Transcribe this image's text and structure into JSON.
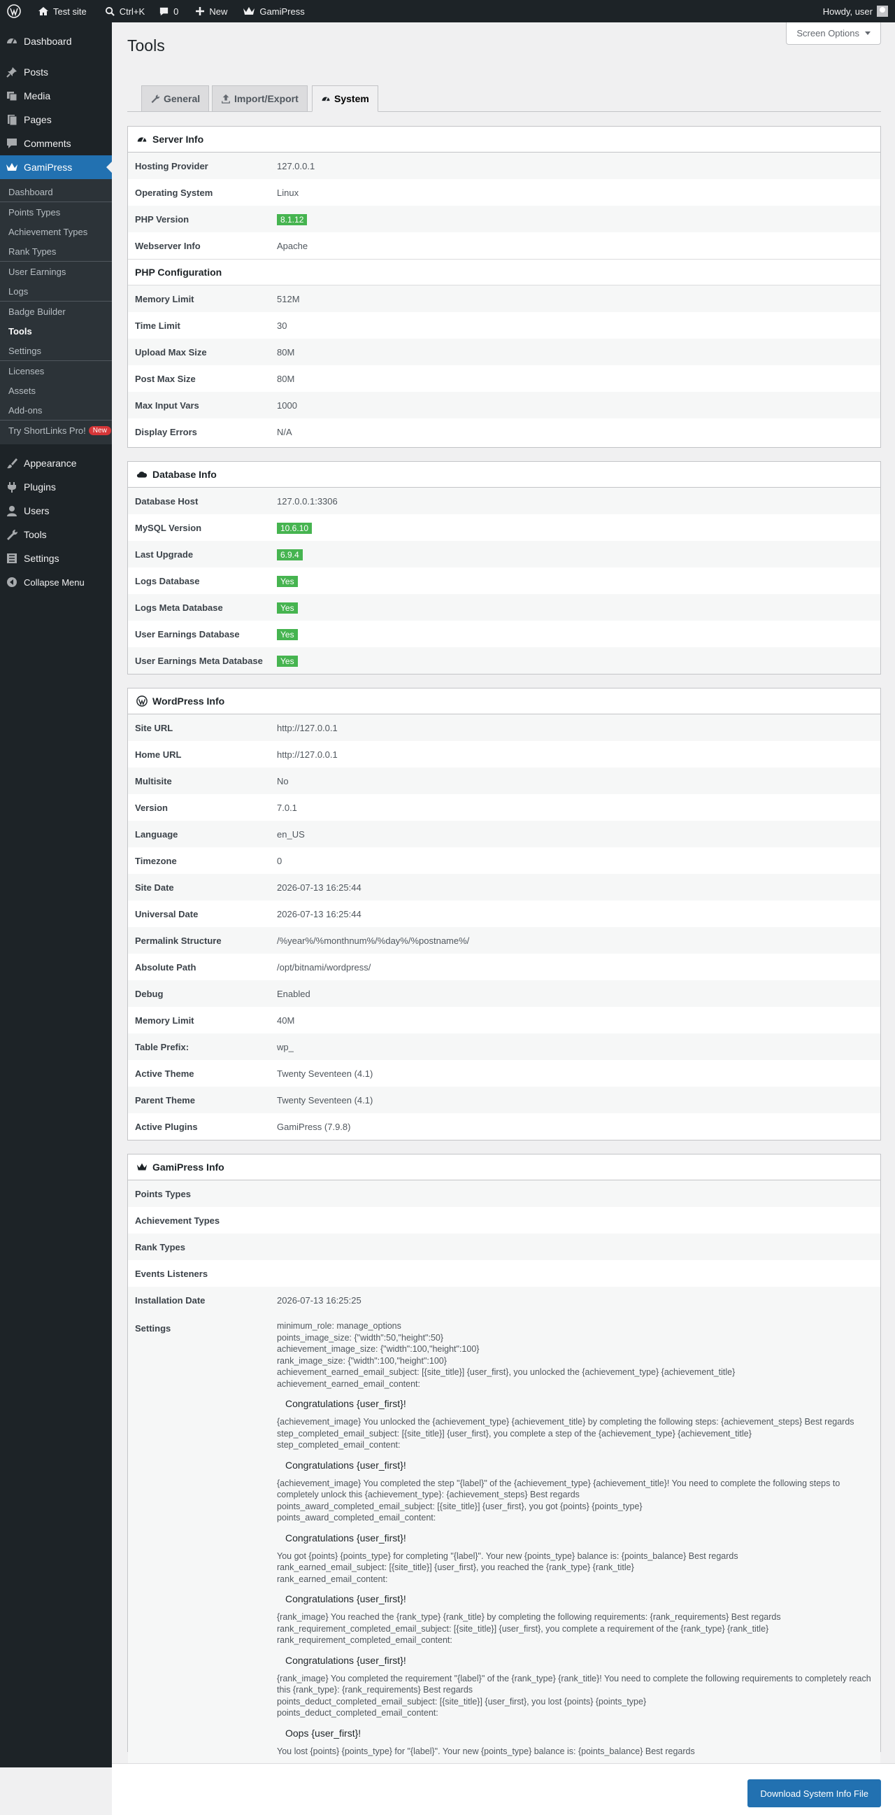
{
  "adminbar": {
    "site_name": "Test site",
    "search_shortcut": "Ctrl+K",
    "comments_count": "0",
    "new_label": "New",
    "plugin_label": "GamiPress",
    "howdy": "Howdy, user"
  },
  "sidebar": {
    "dashboard": "Dashboard",
    "posts": "Posts",
    "media": "Media",
    "pages": "Pages",
    "comments": "Comments",
    "gamipress": "GamiPress",
    "sub": {
      "dashboard": "Dashboard",
      "points_types": "Points Types",
      "achievement_types": "Achievement Types",
      "rank_types": "Rank Types",
      "user_earnings": "User Earnings",
      "logs": "Logs",
      "badge_builder": "Badge Builder",
      "tools": "Tools",
      "settings": "Settings",
      "licenses": "Licenses",
      "assets": "Assets",
      "addons": "Add-ons",
      "try_shortlinks": "Try ShortLinks Pro!",
      "new_badge": "New"
    },
    "appearance": "Appearance",
    "plugins": "Plugins",
    "users": "Users",
    "tools": "Tools",
    "settings": "Settings",
    "collapse": "Collapse Menu"
  },
  "header": {
    "title": "Tools",
    "screen_options": "Screen Options"
  },
  "tabs": {
    "general": "General",
    "import_export": "Import/Export",
    "system": "System"
  },
  "server": {
    "title": "Server Info",
    "rows": [
      [
        "Hosting Provider",
        "127.0.0.1"
      ],
      [
        "Operating System",
        "Linux"
      ],
      [
        "PHP Version",
        "8.1.12"
      ],
      [
        "Webserver Info",
        "Apache"
      ]
    ],
    "php_title": "PHP Configuration",
    "php_rows": [
      [
        "Memory Limit",
        "512M"
      ],
      [
        "Time Limit",
        "30"
      ],
      [
        "Upload Max Size",
        "80M"
      ],
      [
        "Post Max Size",
        "80M"
      ],
      [
        "Max Input Vars",
        "1000"
      ],
      [
        "Display Errors",
        "N/A"
      ]
    ]
  },
  "database": {
    "title": "Database Info",
    "rows": [
      [
        "Database Host",
        "127.0.0.1:3306"
      ],
      [
        "MySQL Version",
        "10.6.10"
      ],
      [
        "Last Upgrade",
        "6.9.4"
      ],
      [
        "Logs Database",
        "Yes"
      ],
      [
        "Logs Meta Database",
        "Yes"
      ],
      [
        "User Earnings Database",
        "Yes"
      ],
      [
        "User Earnings Meta Database",
        "Yes"
      ]
    ]
  },
  "wordpress": {
    "title": "WordPress Info",
    "rows": [
      [
        "Site URL",
        "http://127.0.0.1"
      ],
      [
        "Home URL",
        "http://127.0.0.1"
      ],
      [
        "Multisite",
        "No"
      ],
      [
        "Version",
        "7.0.1"
      ],
      [
        "Language",
        "en_US"
      ],
      [
        "Timezone",
        "0"
      ],
      [
        "Site Date",
        "2026-07-13 16:25:44"
      ],
      [
        "Universal Date",
        "2026-07-13 16:25:44"
      ],
      [
        "Permalink Structure",
        "/%year%/%monthnum%/%day%/%postname%/"
      ],
      [
        "Absolute Path",
        "/opt/bitnami/wordpress/"
      ],
      [
        "Debug",
        "Enabled"
      ],
      [
        "Memory Limit",
        "40M"
      ],
      [
        "Table Prefix:",
        "wp_"
      ],
      [
        "Active Theme",
        "Twenty Seventeen (4.1)"
      ],
      [
        "Parent Theme",
        "Twenty Seventeen (4.1)"
      ],
      [
        "Active Plugins",
        "GamiPress (7.9.8)"
      ]
    ]
  },
  "gamipress": {
    "title": "GamiPress Info",
    "rows": [
      [
        "Points Types",
        ""
      ],
      [
        "Achievement Types",
        ""
      ],
      [
        "Rank Types",
        ""
      ],
      [
        "Events Listeners",
        ""
      ],
      [
        "Installation Date",
        "2026-07-13 16:25:25"
      ]
    ],
    "settings_label": "Settings",
    "settings": {
      "l1": "minimum_role: manage_options",
      "l2": "points_image_size: {\"width\":50,\"height\":50}",
      "l3": "achievement_image_size: {\"width\":100,\"height\":100}",
      "l4": "rank_image_size: {\"width\":100,\"height\":100}",
      "l5": "achievement_earned_email_subject: [{site_title}] {user_first}, you unlocked the {achievement_type} {achievement_title}",
      "l6": "achievement_earned_email_content:",
      "h1": "Congratulations {user_first}!",
      "l7": "{achievement_image} You unlocked the {achievement_type} {achievement_title} by completing the following steps: {achievement_steps} Best regards",
      "l8": "step_completed_email_subject: [{site_title}] {user_first}, you complete a step of the {achievement_type} {achievement_title}",
      "l9": "step_completed_email_content:",
      "h2": "Congratulations {user_first}!",
      "l10": "{achievement_image} You completed the step \"{label}\" of the {achievement_type} {achievement_title}! You need to complete the following steps to completely unlock this {achievement_type}: {achievement_steps} Best regards",
      "l11": "points_award_completed_email_subject: [{site_title}] {user_first}, you got {points} {points_type}",
      "l12": "points_award_completed_email_content:",
      "h3": "Congratulations {user_first}!",
      "l13": "You got {points} {points_type} for completing \"{label}\". Your new {points_type} balance is: {points_balance} Best regards",
      "l14": "rank_earned_email_subject: [{site_title}] {user_first}, you reached the {rank_type} {rank_title}",
      "l15": "rank_earned_email_content:",
      "h4": "Congratulations {user_first}!",
      "l16": "{rank_image} You reached the {rank_type} {rank_title} by completing the following requirements: {rank_requirements} Best regards",
      "l17": "rank_requirement_completed_email_subject: [{site_title}] {user_first}, you complete a requirement of the {rank_type} {rank_title}",
      "l18": "rank_requirement_completed_email_content:",
      "h5": "Congratulations {user_first}!",
      "l19": "{rank_image} You completed the requirement \"{label}\" of the {rank_type} {rank_title}! You need to complete the following requirements to completely reach this {rank_type}: {rank_requirements} Best regards",
      "l20": "points_deduct_completed_email_subject: [{site_title}] {user_first}, you lost {points} {points_type}",
      "l21": "points_deduct_completed_email_content:",
      "h6": "Oops {user_first}!",
      "l22": "You lost {points} {points_type} for \"{label}\". Your new {points_type} balance is: {points_balance} Best regards"
    }
  },
  "footer": {
    "download_button": "Download System Info File"
  }
}
